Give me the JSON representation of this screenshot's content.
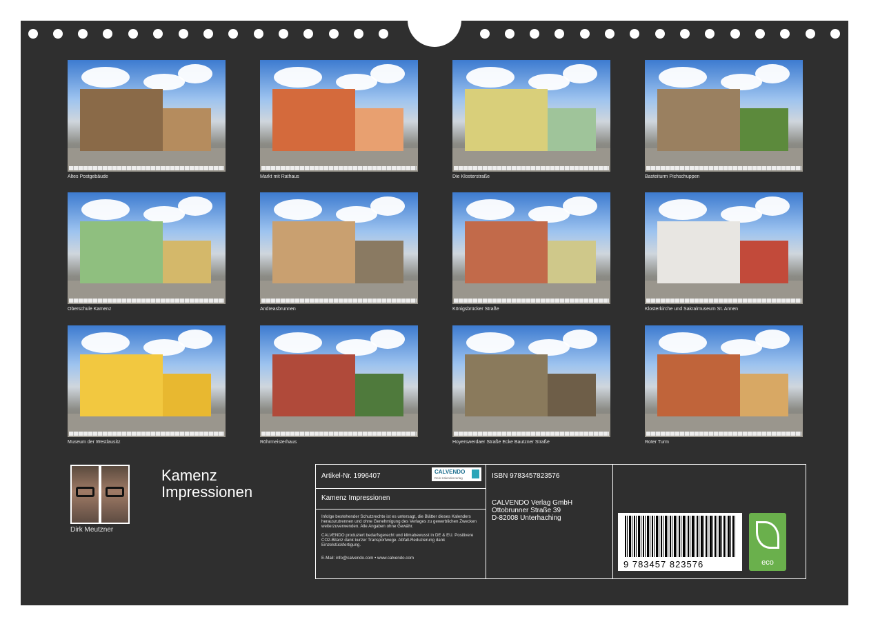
{
  "calendar": {
    "title_line1": "Kamenz",
    "title_line2": "Impressionen",
    "author": "Dirk Meutzner",
    "photos": [
      {
        "caption": "Altes Postgebäude"
      },
      {
        "caption": "Markt mit Rathaus"
      },
      {
        "caption": "Die Klosterstraße"
      },
      {
        "caption": "Basteiturm Pichschuppen"
      },
      {
        "caption": "Oberschule Kamenz"
      },
      {
        "caption": "Andreasbrunnen"
      },
      {
        "caption": "Königsbrücker Straße"
      },
      {
        "caption": "Klosterkirche und Sakralmuseum St. Annen"
      },
      {
        "caption": "Museum der Westlausitz"
      },
      {
        "caption": "Röhrmeisterhaus"
      },
      {
        "caption": "Hoyerswerdaer Straße Ecke Bautzner Straße"
      },
      {
        "caption": "Roter Turm"
      }
    ]
  },
  "imprint": {
    "article": "Artikel-Nr. 1996407",
    "logo": "CALVENDO",
    "logo_sub": "Dein Kalenderverlag",
    "product_title": "Kamenz Impressionen",
    "legal": "Infolge bestehender Schutzrechte ist es untersagt, die Blätter dieses Kalenders herauszutrennen und ohne Genehmigung des Verlages zu gewerblichen Zwecken weiterzuverwenden. Alle Angaben ohne Gewähr.",
    "eco_note": "CALVENDO produziert bedarfsgerecht und klimabewusst in DE & EU. Positivere CO2-Bilanz dank kurzer Transportwege. Abfall-Reduzierung dank Einzelstückfertigung.",
    "contact": "E-Mail: info@calvendo.com • www.calvendo.com",
    "isbn": "ISBN 9783457823576",
    "publisher_name": "CALVENDO Verlag GmbH",
    "publisher_street": "Ottobrunner Straße 39",
    "publisher_city": "D-82008 Unterhaching",
    "barcode_number": "9 783457 823576",
    "eco_label": "eco"
  }
}
